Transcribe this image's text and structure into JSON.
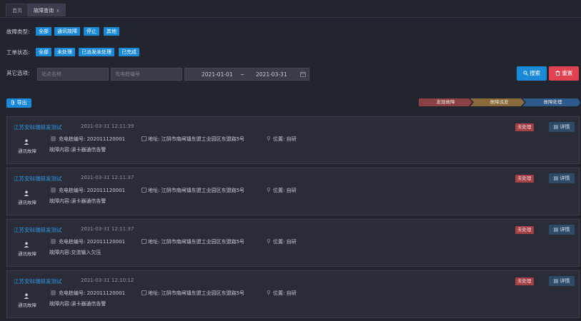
{
  "tabs": [
    {
      "label": "首页"
    },
    {
      "label": "故障查询",
      "close": "x"
    }
  ],
  "filters": {
    "fault_type": {
      "label": "故障类型:",
      "options": [
        "全部",
        "通讯故障",
        "停止",
        "其他"
      ]
    },
    "order_status": {
      "label": "工单状态:",
      "options": [
        "全部",
        "未处理",
        "已派发未处理",
        "已完成"
      ]
    },
    "other": {
      "label": "其它选项:",
      "station_placeholder": "站点名称",
      "pile_placeholder": "充电桩编号",
      "date_start": "2021-01-01",
      "date_sep": "~",
      "date_end": "2021-03-31"
    }
  },
  "actions": {
    "search": "搜索",
    "reset": "重置",
    "export": "导出"
  },
  "legend": [
    "发现故障",
    "故障派发",
    "故障处理"
  ],
  "colors": {
    "accent": "#1a8ad8",
    "danger": "#e0434f",
    "status": "#a24145",
    "legend1": "#8a4045",
    "legend2": "#8a6a3a",
    "legend3": "#2c5a8a"
  },
  "records": [
    {
      "title": "江苏安科瑞研发测试",
      "time": "2021-03-31 12:11:39",
      "type": "通讯故障",
      "pile": "充电桩编号: 202011120001",
      "address": "地址: 江阴市南闸镇东盟工业园区东盟路5号",
      "position": "位置: 自研",
      "content": "故障内容:读卡器通信告警",
      "status": "未处理",
      "detail": "详情"
    },
    {
      "title": "江苏安科瑞研发测试",
      "time": "2021-03-31 12:11:37",
      "type": "通讯故障",
      "pile": "充电桩编号: 202011120001",
      "address": "地址: 江阴市南闸镇东盟工业园区东盟路5号",
      "position": "位置: 自研",
      "content": "故障内容:读卡器通信告警",
      "status": "未处理",
      "detail": "详情"
    },
    {
      "title": "江苏安科瑞研发测试",
      "time": "2021-03-31 12:11:37",
      "type": "通讯故障",
      "pile": "充电桩编号: 202011120001",
      "address": "地址: 江阴市南闸镇东盟工业园区东盟路5号",
      "position": "位置: 自研",
      "content": "故障内容:交流输入欠压",
      "status": "未处理",
      "detail": "详情"
    },
    {
      "title": "江苏安科瑞研发测试",
      "time": "2021-03-31 12:10:12",
      "type": "通讯故障",
      "pile": "充电桩编号: 202011120001",
      "address": "地址: 江阴市南闸镇东盟工业园区东盟路5号",
      "position": "位置: 自研",
      "content": "故障内容:读卡器通信告警",
      "status": "未处理",
      "detail": "详情"
    }
  ]
}
